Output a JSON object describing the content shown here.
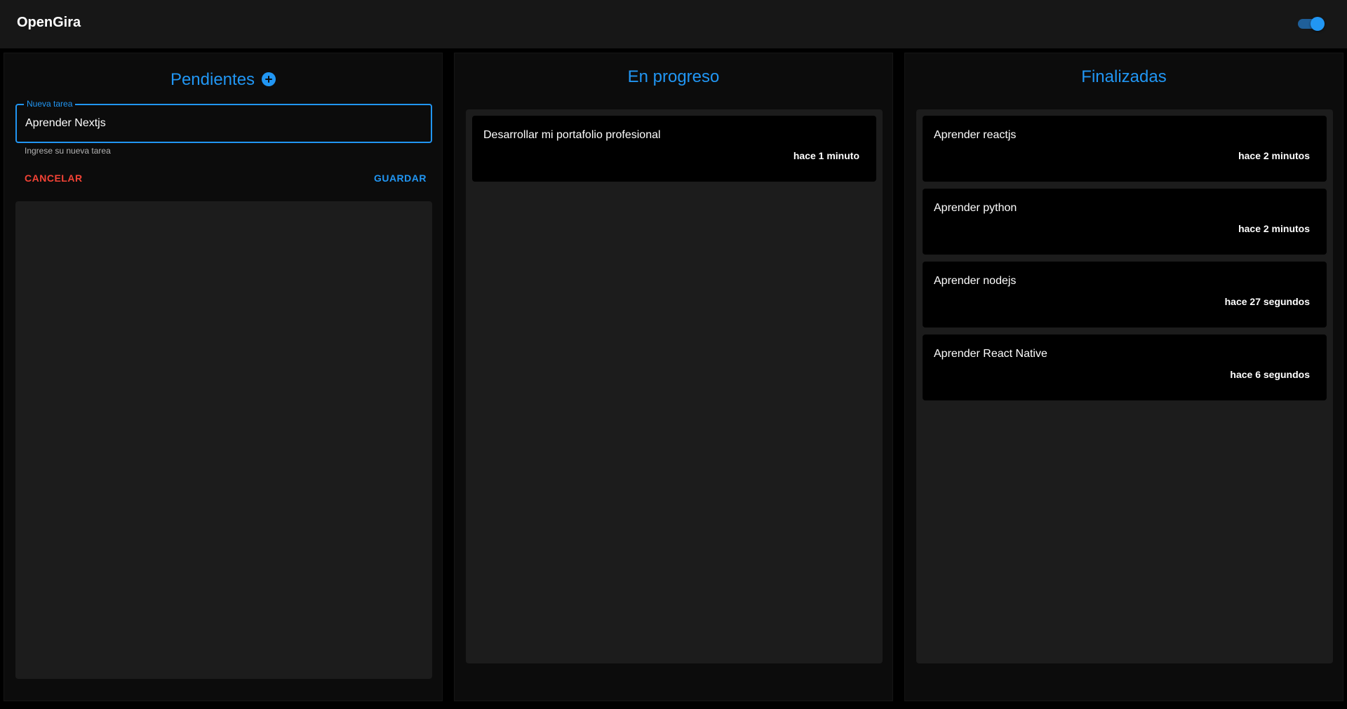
{
  "app": {
    "title": "OpenGira",
    "theme_toggle": {
      "checked": true,
      "accent": "#2196f3"
    }
  },
  "columns": {
    "pending": {
      "title": "Pendientes",
      "add_icon": "add-circle-icon",
      "new_task_form": {
        "label": "Nueva tarea",
        "value": "Aprender Nextjs",
        "helper": "Ingrese su nueva tarea",
        "cancel_label": "CANCELAR",
        "save_label": "GUARDAR"
      },
      "tasks": []
    },
    "in_progress": {
      "title": "En progreso",
      "tasks": [
        {
          "title": "Desarrollar mi portafolio profesional",
          "time": "hace 1 minuto"
        }
      ]
    },
    "done": {
      "title": "Finalizadas",
      "tasks": [
        {
          "title": "Aprender reactjs",
          "time": "hace 2 minutos"
        },
        {
          "title": "Aprender python",
          "time": "hace 2 minutos"
        },
        {
          "title": "Aprender nodejs",
          "time": "hace 27 segundos"
        },
        {
          "title": "Aprender React Native",
          "time": "hace 6 segundos"
        }
      ]
    }
  },
  "colors": {
    "accent": "#2196f3",
    "danger": "#f44336",
    "appbar": "#171717",
    "column": "#0c0c0c",
    "list": "#1c1c1c",
    "card": "#000000"
  }
}
